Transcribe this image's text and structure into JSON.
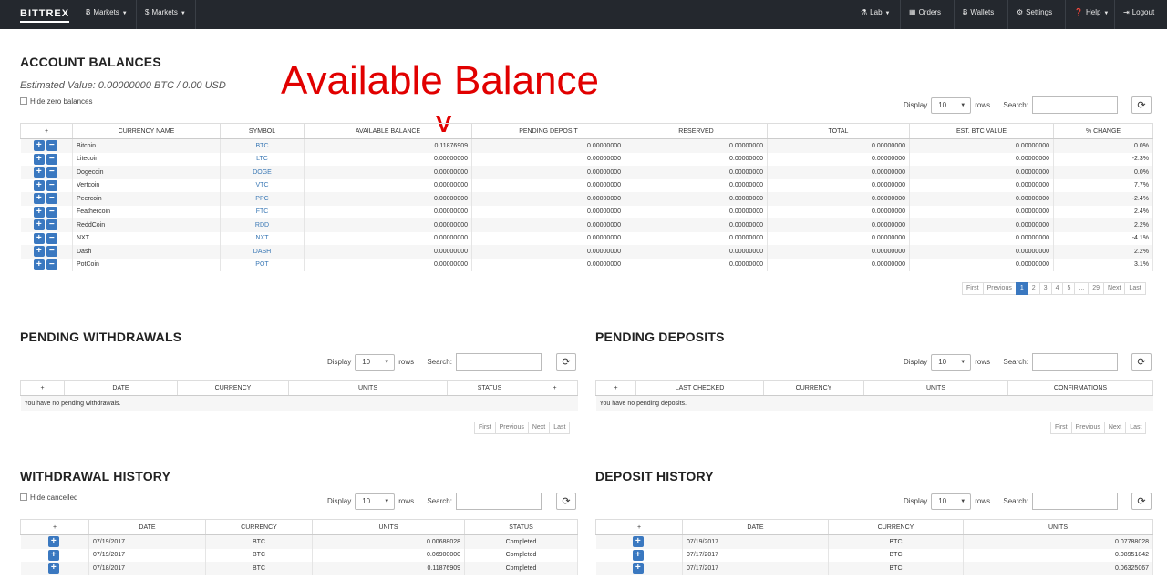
{
  "nav": {
    "logo": "BITTREX",
    "left": [
      {
        "icon": "bitcoin-icon",
        "glyph": "Ƀ",
        "label": "Markets"
      },
      {
        "icon": "dollar-icon",
        "glyph": "$",
        "label": "Markets"
      }
    ],
    "right": [
      {
        "icon": "flask-icon",
        "glyph": "⚗",
        "label": "Lab",
        "caret": true
      },
      {
        "icon": "calendar-icon",
        "glyph": "▦",
        "label": "Orders",
        "caret": false
      },
      {
        "icon": "bitcoin-icon",
        "glyph": "Ƀ",
        "label": "Wallets",
        "caret": false
      },
      {
        "icon": "gear-icon",
        "glyph": "⚙",
        "label": "Settings",
        "caret": false
      },
      {
        "icon": "help-icon",
        "glyph": "❓",
        "label": "Help",
        "caret": true
      },
      {
        "icon": "logout-icon",
        "glyph": "⇥",
        "label": "Logout",
        "caret": false
      }
    ]
  },
  "annotation": {
    "text": "Available Balance",
    "arrow": "V"
  },
  "balances": {
    "title": "ACCOUNT BALANCES",
    "estimated": "Estimated Value: 0.00000000 BTC / 0.00 USD",
    "hide_zero": "Hide zero balances",
    "display_label": "Display",
    "rows_value": "10",
    "rows_label": "rows",
    "search_label": "Search:",
    "columns": [
      "+",
      "CURRENCY NAME",
      "SYMBOL",
      "AVAILABLE BALANCE",
      "PENDING DEPOSIT",
      "RESERVED",
      "TOTAL",
      "EST. BTC VALUE",
      "% CHANGE"
    ],
    "rows": [
      {
        "name": "Bitcoin",
        "symbol": "BTC",
        "available": "0.11876909",
        "pending": "0.00000000",
        "reserved": "0.00000000",
        "total": "0.00000000",
        "btc": "0.00000000",
        "change": "0.0%"
      },
      {
        "name": "Litecoin",
        "symbol": "LTC",
        "available": "0.00000000",
        "pending": "0.00000000",
        "reserved": "0.00000000",
        "total": "0.00000000",
        "btc": "0.00000000",
        "change": "-2.3%"
      },
      {
        "name": "Dogecoin",
        "symbol": "DOGE",
        "available": "0.00000000",
        "pending": "0.00000000",
        "reserved": "0.00000000",
        "total": "0.00000000",
        "btc": "0.00000000",
        "change": "0.0%"
      },
      {
        "name": "Vertcoin",
        "symbol": "VTC",
        "available": "0.00000000",
        "pending": "0.00000000",
        "reserved": "0.00000000",
        "total": "0.00000000",
        "btc": "0.00000000",
        "change": "7.7%"
      },
      {
        "name": "Peercoin",
        "symbol": "PPC",
        "available": "0.00000000",
        "pending": "0.00000000",
        "reserved": "0.00000000",
        "total": "0.00000000",
        "btc": "0.00000000",
        "change": "-2.4%"
      },
      {
        "name": "Feathercoin",
        "symbol": "FTC",
        "available": "0.00000000",
        "pending": "0.00000000",
        "reserved": "0.00000000",
        "total": "0.00000000",
        "btc": "0.00000000",
        "change": "2.4%"
      },
      {
        "name": "ReddCoin",
        "symbol": "RDD",
        "available": "0.00000000",
        "pending": "0.00000000",
        "reserved": "0.00000000",
        "total": "0.00000000",
        "btc": "0.00000000",
        "change": "2.2%"
      },
      {
        "name": "NXT",
        "symbol": "NXT",
        "available": "0.00000000",
        "pending": "0.00000000",
        "reserved": "0.00000000",
        "total": "0.00000000",
        "btc": "0.00000000",
        "change": "-4.1%"
      },
      {
        "name": "Dash",
        "symbol": "DASH",
        "available": "0.00000000",
        "pending": "0.00000000",
        "reserved": "0.00000000",
        "total": "0.00000000",
        "btc": "0.00000000",
        "change": "2.2%"
      },
      {
        "name": "PotCoin",
        "symbol": "POT",
        "available": "0.00000000",
        "pending": "0.00000000",
        "reserved": "0.00000000",
        "total": "0.00000000",
        "btc": "0.00000000",
        "change": "3.1%"
      }
    ],
    "pager": [
      "First",
      "Previous",
      "1",
      "2",
      "3",
      "4",
      "5",
      "...",
      "29",
      "Next",
      "Last"
    ],
    "pager_active": "1"
  },
  "pending_withdrawals": {
    "title": "PENDING WITHDRAWALS",
    "display_label": "Display",
    "rows_value": "10",
    "rows_label": "rows",
    "search_label": "Search:",
    "columns": [
      "+",
      "DATE",
      "CURRENCY",
      "UNITS",
      "STATUS",
      "+"
    ],
    "empty": "You have no pending withdrawals.",
    "pager": [
      "First",
      "Previous",
      "Next",
      "Last"
    ]
  },
  "pending_deposits": {
    "title": "PENDING DEPOSITS",
    "display_label": "Display",
    "rows_value": "10",
    "rows_label": "rows",
    "search_label": "Search:",
    "columns": [
      "+",
      "LAST CHECKED",
      "CURRENCY",
      "UNITS",
      "CONFIRMATIONS"
    ],
    "empty": "You have no pending deposits.",
    "pager": [
      "First",
      "Previous",
      "Next",
      "Last"
    ]
  },
  "withdrawal_history": {
    "title": "WITHDRAWAL HISTORY",
    "hide_cancelled": "Hide cancelled",
    "display_label": "Display",
    "rows_value": "10",
    "rows_label": "rows",
    "search_label": "Search:",
    "columns": [
      "+",
      "DATE",
      "CURRENCY",
      "UNITS",
      "STATUS"
    ],
    "rows": [
      {
        "date": "07/19/2017",
        "currency": "BTC",
        "units": "0.00688028",
        "status": "Completed"
      },
      {
        "date": "07/19/2017",
        "currency": "BTC",
        "units": "0.06900000",
        "status": "Completed"
      },
      {
        "date": "07/18/2017",
        "currency": "BTC",
        "units": "0.11876909",
        "status": "Completed"
      }
    ]
  },
  "deposit_history": {
    "title": "DEPOSIT HISTORY",
    "display_label": "Display",
    "rows_value": "10",
    "rows_label": "rows",
    "search_label": "Search:",
    "columns": [
      "+",
      "DATE",
      "CURRENCY",
      "UNITS"
    ],
    "rows": [
      {
        "date": "07/19/2017",
        "currency": "BTC",
        "units": "0.07788028"
      },
      {
        "date": "07/17/2017",
        "currency": "BTC",
        "units": "0.08951842"
      },
      {
        "date": "07/17/2017",
        "currency": "BTC",
        "units": "0.06325067"
      }
    ]
  }
}
